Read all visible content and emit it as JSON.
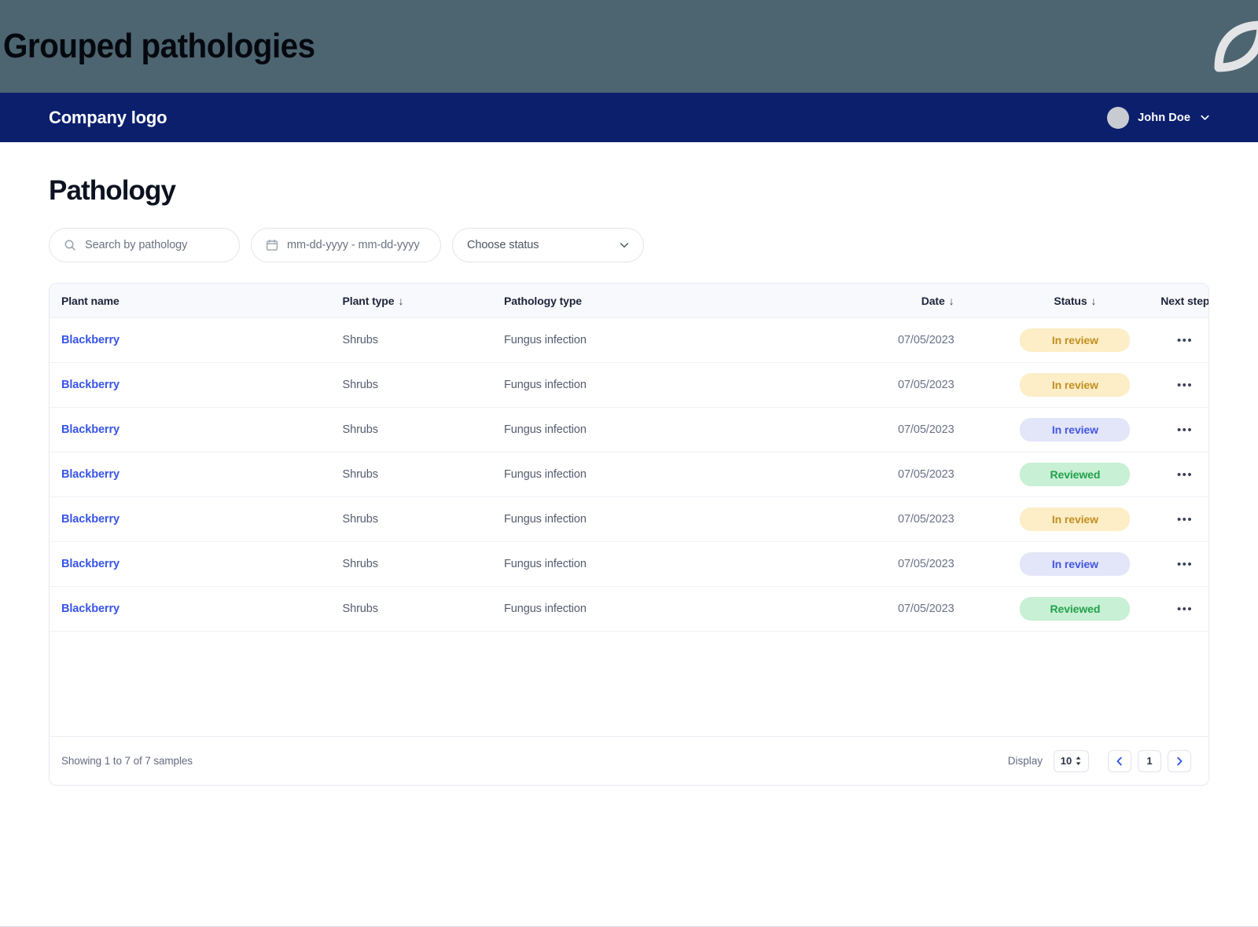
{
  "banner": {
    "title": "Grouped pathologies",
    "logo_icon": "leaf-logo-icon",
    "bg_color": "#4d6571"
  },
  "navbar": {
    "brand": "Company logo",
    "user_name": "John Doe",
    "avatar_icon": "avatar",
    "chevron_icon": "chevron-down-icon",
    "bg_color": "#0b1f6d"
  },
  "page": {
    "title": "Pathology"
  },
  "filters": {
    "search": {
      "placeholder": "Search by pathology",
      "value": "",
      "icon": "search-icon"
    },
    "date_range": {
      "placeholder": "mm-dd-yyyy - mm-dd-yyyy",
      "value": "",
      "icon": "calendar-icon"
    },
    "status": {
      "selected": "Choose status",
      "icon": "chevron-down-icon",
      "options": [
        "Choose status",
        "In review",
        "Reviewed"
      ]
    }
  },
  "table": {
    "columns": [
      {
        "label": "Plant name",
        "sortable": false,
        "sort_icon": ""
      },
      {
        "label": "Plant type",
        "sortable": true,
        "sort_icon": "↓"
      },
      {
        "label": "Pathology type",
        "sortable": false,
        "sort_icon": ""
      },
      {
        "label": "Date",
        "sortable": true,
        "sort_icon": "↓"
      },
      {
        "label": "Status",
        "sortable": true,
        "sort_icon": "↓"
      },
      {
        "label": "Next step",
        "sortable": false,
        "sort_icon": ""
      }
    ],
    "rows": [
      {
        "plant_name": "Blackberry",
        "plant_type": "Shrubs",
        "pathology_type": "Fungus infection",
        "date": "07/05/2023",
        "status": "In review",
        "status_variant": "warning",
        "next_step_icon": "ellipsis-icon"
      },
      {
        "plant_name": "Blackberry",
        "plant_type": "Shrubs",
        "pathology_type": "Fungus infection",
        "date": "07/05/2023",
        "status": "In review",
        "status_variant": "warning",
        "next_step_icon": "ellipsis-icon"
      },
      {
        "plant_name": "Blackberry",
        "plant_type": "Shrubs",
        "pathology_type": "Fungus infection",
        "date": "07/05/2023",
        "status": "In review",
        "status_variant": "info",
        "next_step_icon": "ellipsis-icon"
      },
      {
        "plant_name": "Blackberry",
        "plant_type": "Shrubs",
        "pathology_type": "Fungus infection",
        "date": "07/05/2023",
        "status": "Reviewed",
        "status_variant": "success",
        "next_step_icon": "ellipsis-icon"
      },
      {
        "plant_name": "Blackberry",
        "plant_type": "Shrubs",
        "pathology_type": "Fungus infection",
        "date": "07/05/2023",
        "status": "In review",
        "status_variant": "warning",
        "next_step_icon": "ellipsis-icon"
      },
      {
        "plant_name": "Blackberry",
        "plant_type": "Shrubs",
        "pathology_type": "Fungus infection",
        "date": "07/05/2023",
        "status": "In review",
        "status_variant": "info",
        "next_step_icon": "ellipsis-icon"
      },
      {
        "plant_name": "Blackberry",
        "plant_type": "Shrubs",
        "pathology_type": "Fungus infection",
        "date": "07/05/2023",
        "status": "Reviewed",
        "status_variant": "success",
        "next_step_icon": "ellipsis-icon"
      }
    ],
    "kebab_label": "•••"
  },
  "footer": {
    "showing_text": "Showing 1 to 7 of 7 samples",
    "display_label": "Display",
    "display_value": "10",
    "page_number": "1",
    "prev_icon": "chevron-left-icon",
    "next_icon": "chevron-right-icon"
  },
  "colors": {
    "brand_navy": "#0b1f6d",
    "banner_slate": "#4d6571",
    "link_blue": "#3754e8",
    "badge_warning_bg": "#fdeec8",
    "badge_warning_fg": "#c28f21",
    "badge_info_bg": "#e3e5f8",
    "badge_info_fg": "#4356e0",
    "badge_success_bg": "#c8f0d4",
    "badge_success_fg": "#22a04c"
  }
}
